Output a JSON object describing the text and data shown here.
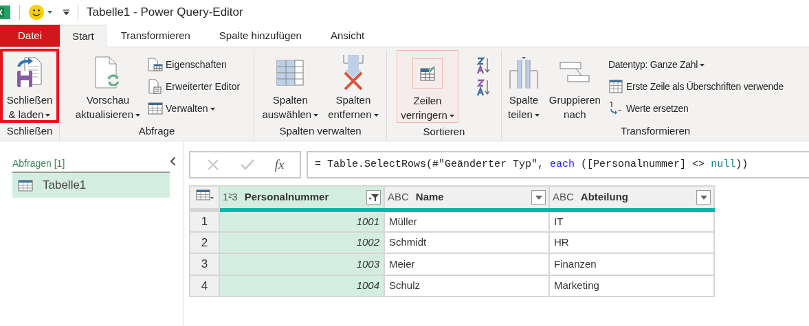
{
  "window": {
    "title": "Tabelle1 - Power Query-Editor"
  },
  "tabs": [
    {
      "label": "Datei",
      "kind": "file",
      "selected": false
    },
    {
      "label": "Start",
      "kind": "tab",
      "selected": true
    },
    {
      "label": "Transformieren",
      "kind": "tab",
      "selected": false
    },
    {
      "label": "Spalte hinzufügen",
      "kind": "tab",
      "selected": false
    },
    {
      "label": "Ansicht",
      "kind": "tab",
      "selected": false
    }
  ],
  "ribbon": {
    "groups": [
      {
        "label": "Schließen",
        "items": [
          {
            "kind": "large",
            "lines": [
              "Schließen",
              "& laden"
            ],
            "dropdown": true,
            "outlined": true
          }
        ]
      },
      {
        "label": "Abfrage",
        "items": [
          {
            "kind": "large",
            "lines": [
              "Vorschau",
              "aktualisieren"
            ],
            "dropdown": true
          },
          {
            "kind": "stack",
            "entries": [
              {
                "label": "Eigenschaften",
                "dropdown": false
              },
              {
                "label": "Erweiterter Editor",
                "dropdown": false
              },
              {
                "label": "Verwalten",
                "dropdown": true
              }
            ]
          }
        ]
      },
      {
        "label": "Spalten verwalten",
        "items": [
          {
            "kind": "large",
            "lines": [
              "Spalten",
              "auswählen"
            ],
            "dropdown": true
          },
          {
            "kind": "large",
            "lines": [
              "Spalten",
              "entfernen"
            ],
            "dropdown": true
          }
        ]
      },
      {
        "label": "Sortieren",
        "items": [
          {
            "kind": "large",
            "lines": [
              "Zeilen",
              "verringern"
            ],
            "dropdown": true,
            "hovered": true
          },
          {
            "kind": "sort"
          }
        ]
      },
      {
        "label": "Transformieren",
        "items": [
          {
            "kind": "large",
            "lines": [
              "Spalte",
              "teilen"
            ],
            "dropdown": true
          },
          {
            "kind": "large",
            "lines": [
              "Gruppieren",
              "nach"
            ],
            "dropdown": false
          },
          {
            "kind": "stack",
            "entries": [
              {
                "label": "Datentyp: Ganze Zahl",
                "dropdown": true
              },
              {
                "label": "Erste Zeile als Überschriften verwende",
                "dropdown": false
              },
              {
                "label": "Werte ersetzen",
                "dropdown": false
              }
            ]
          }
        ]
      }
    ]
  },
  "sidebar": {
    "title": "Abfragen [1]",
    "items": [
      {
        "label": "Tabelle1",
        "selected": true
      }
    ]
  },
  "formula": {
    "function_label": "fx",
    "tokens": [
      {
        "text": "= Table.SelectRows(#\"Geänderter Typ\", ",
        "kind": "plain"
      },
      {
        "text": "each",
        "kind": "keyword"
      },
      {
        "text": " ([Personalnummer] <> ",
        "kind": "plain"
      },
      {
        "text": "null",
        "kind": "constant"
      },
      {
        "text": "))",
        "kind": "plain"
      }
    ]
  },
  "table": {
    "columns": [
      {
        "type_label": "1²3",
        "label": "Personalnummer",
        "selected": true,
        "filtered": true,
        "kind": "number"
      },
      {
        "type_label": "ABC",
        "label": "Name",
        "selected": false,
        "filtered": false,
        "kind": "text"
      },
      {
        "type_label": "ABC",
        "label": "Abteilung",
        "selected": false,
        "filtered": false,
        "kind": "text"
      }
    ],
    "rows": [
      {
        "number": "1",
        "cells": [
          "1001",
          "Müller",
          "IT"
        ]
      },
      {
        "number": "2",
        "cells": [
          "1002",
          "Schmidt",
          "HR"
        ]
      },
      {
        "number": "3",
        "cells": [
          "1003",
          "Meier",
          "Finanzen"
        ]
      },
      {
        "number": "4",
        "cells": [
          "1004",
          "Schulz",
          "Marketing"
        ]
      }
    ]
  }
}
